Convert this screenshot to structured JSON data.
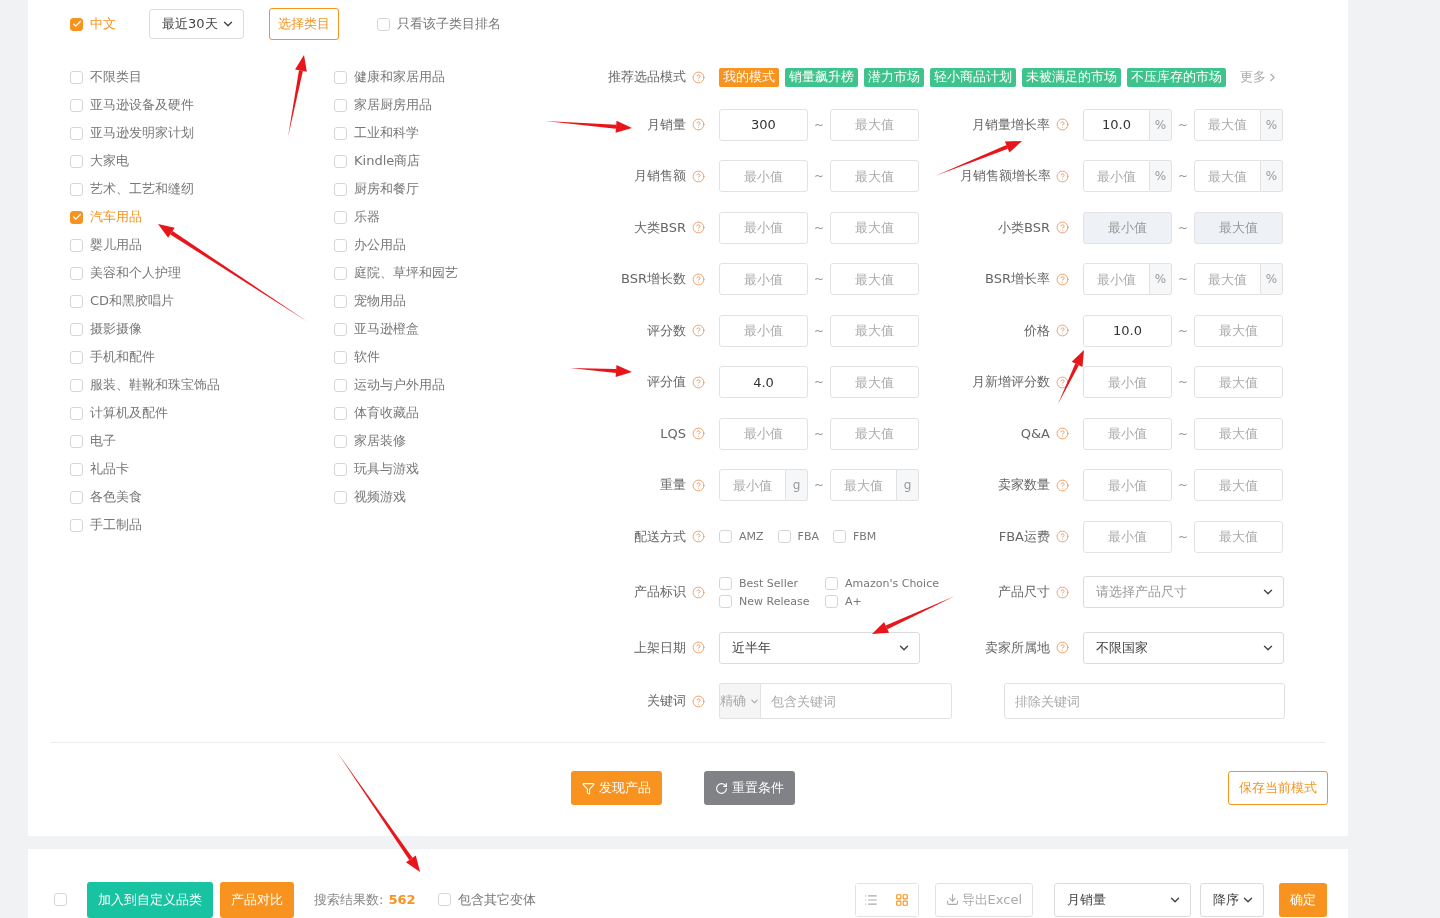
{
  "top_bar": {
    "language": {
      "label": "中文",
      "checked": true
    },
    "period_select": "最近30天",
    "choose_category_button": "选择类目",
    "subcategory_rank": {
      "label": "只看该子类目排名",
      "checked": false
    }
  },
  "categories": [
    {
      "label": "不限类目",
      "checked": false
    },
    {
      "label": "亚马逊设备及硬件",
      "checked": false
    },
    {
      "label": "亚马逊发明家计划",
      "checked": false
    },
    {
      "label": "大家电",
      "checked": false
    },
    {
      "label": "艺术、工艺和缝纫",
      "checked": false
    },
    {
      "label": "汽车用品",
      "checked": true
    },
    {
      "label": "婴儿用品",
      "checked": false
    },
    {
      "label": "美容和个人护理",
      "checked": false
    },
    {
      "label": "CD和黑胶唱片",
      "checked": false
    },
    {
      "label": "摄影摄像",
      "checked": false
    },
    {
      "label": "手机和配件",
      "checked": false
    },
    {
      "label": "服装、鞋靴和珠宝饰品",
      "checked": false
    },
    {
      "label": "计算机及配件",
      "checked": false
    },
    {
      "label": "电子",
      "checked": false
    },
    {
      "label": "礼品卡",
      "checked": false
    },
    {
      "label": "各色美食",
      "checked": false
    },
    {
      "label": "手工制品",
      "checked": false
    },
    {
      "label": "健康和家居用品",
      "checked": false
    },
    {
      "label": "家居厨房用品",
      "checked": false
    },
    {
      "label": "工业和科学",
      "checked": false
    },
    {
      "label": "Kindle商店",
      "checked": false
    },
    {
      "label": "厨房和餐厅",
      "checked": false
    },
    {
      "label": "乐器",
      "checked": false
    },
    {
      "label": "办公用品",
      "checked": false
    },
    {
      "label": "庭院、草坪和园艺",
      "checked": false
    },
    {
      "label": "宠物用品",
      "checked": false
    },
    {
      "label": "亚马逊橙盒",
      "checked": false
    },
    {
      "label": "软件",
      "checked": false
    },
    {
      "label": "运动与户外用品",
      "checked": false
    },
    {
      "label": "体育收藏品",
      "checked": false
    },
    {
      "label": "家居装修",
      "checked": false
    },
    {
      "label": "玩具与游戏",
      "checked": false
    },
    {
      "label": "视频游戏",
      "checked": false
    }
  ],
  "modes": {
    "label": "推荐选品模式",
    "tags": [
      {
        "label": "我的模式",
        "selected": true
      },
      {
        "label": "销量飙升榜",
        "selected": false
      },
      {
        "label": "潜力市场",
        "selected": false
      },
      {
        "label": "轻小商品计划",
        "selected": false
      },
      {
        "label": "未被满足的市场",
        "selected": false
      },
      {
        "label": "不压库存的市场",
        "selected": false
      }
    ],
    "more": "更多"
  },
  "fields": [
    {
      "kind": "range",
      "label": "月销量",
      "disabled": false,
      "min": {
        "value": "300"
      },
      "separator": "~",
      "max": {
        "placeholder": "最大值"
      }
    },
    {
      "kind": "range",
      "label": "月销量增长率",
      "disabled": false,
      "min": {
        "value": "10.0",
        "unit": "%"
      },
      "separator": "~",
      "max": {
        "placeholder": "最大值",
        "unit": "%"
      }
    },
    {
      "kind": "range",
      "label": "月销售额",
      "disabled": false,
      "min": {
        "placeholder": "最小值"
      },
      "separator": "~",
      "max": {
        "placeholder": "最大值"
      }
    },
    {
      "kind": "range",
      "label": "月销售额增长率",
      "disabled": false,
      "min": {
        "placeholder": "最小值",
        "unit": "%"
      },
      "separator": "~",
      "max": {
        "placeholder": "最大值",
        "unit": "%"
      }
    },
    {
      "kind": "range",
      "label": "大类BSR",
      "disabled": false,
      "min": {
        "placeholder": "最小值"
      },
      "separator": "~",
      "max": {
        "placeholder": "最大值"
      }
    },
    {
      "kind": "range",
      "label": "小类BSR",
      "disabled": true,
      "min": {
        "placeholder": "最小值"
      },
      "separator": "~",
      "max": {
        "placeholder": "最大值"
      }
    },
    {
      "kind": "range",
      "label": "BSR增长数",
      "disabled": false,
      "min": {
        "placeholder": "最小值"
      },
      "separator": "~",
      "max": {
        "placeholder": "最大值"
      }
    },
    {
      "kind": "range",
      "label": "BSR增长率",
      "disabled": false,
      "min": {
        "placeholder": "最小值",
        "unit": "%"
      },
      "separator": "~",
      "max": {
        "placeholder": "最大值",
        "unit": "%"
      }
    },
    {
      "kind": "range",
      "label": "评分数",
      "disabled": false,
      "min": {
        "placeholder": "最小值"
      },
      "separator": "~",
      "max": {
        "placeholder": "最大值"
      }
    },
    {
      "kind": "range",
      "label": "价格",
      "disabled": false,
      "min": {
        "value": "10.0"
      },
      "separator": "~",
      "max": {
        "placeholder": "最大值"
      }
    },
    {
      "kind": "range",
      "label": "评分值",
      "disabled": false,
      "min": {
        "value": "4.0"
      },
      "separator": "~",
      "max": {
        "placeholder": "最大值"
      }
    },
    {
      "kind": "range",
      "label": "月新增评分数",
      "disabled": false,
      "min": {
        "placeholder": "最小值"
      },
      "separator": "~",
      "max": {
        "placeholder": "最大值"
      }
    },
    {
      "kind": "range",
      "label": "LQS",
      "disabled": false,
      "min": {
        "placeholder": "最小值"
      },
      "separator": "~",
      "max": {
        "placeholder": "最大值"
      }
    },
    {
      "kind": "range",
      "label": "Q&A",
      "disabled": false,
      "min": {
        "placeholder": "最小值"
      },
      "separator": "~",
      "max": {
        "placeholder": "最大值"
      }
    },
    {
      "kind": "range",
      "label": "重量",
      "disabled": false,
      "min": {
        "placeholder": "最小值",
        "unit": "g"
      },
      "separator": "~",
      "max": {
        "placeholder": "最大值",
        "unit": "g"
      }
    },
    {
      "kind": "range",
      "label": "卖家数量",
      "disabled": false,
      "min": {
        "placeholder": "最小值"
      },
      "separator": "~",
      "max": {
        "placeholder": "最大值"
      }
    },
    {
      "kind": "checks",
      "label": "配送方式",
      "options": [
        {
          "label": "AMZ",
          "checked": false
        },
        {
          "label": "FBA",
          "checked": false
        },
        {
          "label": "FBM",
          "checked": false
        }
      ]
    },
    {
      "kind": "range",
      "label": "FBA运费",
      "disabled": false,
      "min": {
        "placeholder": "最小值"
      },
      "separator": "~",
      "max": {
        "placeholder": "最大值"
      }
    },
    {
      "kind": "checkgrid",
      "label": "产品标识",
      "options": [
        {
          "label": "Best Seller",
          "checked": false
        },
        {
          "label": "Amazon's Choice",
          "checked": false
        },
        {
          "label": "New Release",
          "checked": false
        },
        {
          "label": "A+",
          "checked": false
        }
      ]
    },
    {
      "kind": "select",
      "label": "产品尺寸",
      "placeholder": "请选择产品尺寸"
    },
    {
      "kind": "select",
      "label": "上架日期",
      "value": "近半年"
    },
    {
      "kind": "select",
      "label": "卖家所属地",
      "value": "不限国家"
    },
    {
      "kind": "keyword",
      "label": "关键词",
      "mode": "精确",
      "placeholder": "包含关键词"
    },
    {
      "kind": "input",
      "placeholder": "排除关键词"
    }
  ],
  "actions": {
    "discover": "发现产品",
    "reset": "重置条件",
    "save": "保存当前模式"
  },
  "bottom_bar": {
    "select_all": {
      "checked": false
    },
    "add_button": "加入到自定义品类",
    "compare_button": "产品对比",
    "result_label": "搜索结果数:",
    "result_count": "562",
    "include_variants": {
      "label": "包含其它变体",
      "checked": false
    },
    "views": [
      {
        "kind": "list",
        "selected": false
      },
      {
        "kind": "grid",
        "selected": true
      }
    ],
    "export_button": "导出Excel",
    "sort_select": "月销量",
    "order_select": "降序",
    "confirm_button": "确定"
  },
  "annotations": [
    {
      "kind": "arrow"
    },
    {
      "kind": "arrow"
    },
    {
      "kind": "arrow"
    },
    {
      "kind": "arrow"
    },
    {
      "kind": "arrow"
    },
    {
      "kind": "arrow"
    },
    {
      "kind": "arrow"
    },
    {
      "kind": "arrow"
    }
  ]
}
